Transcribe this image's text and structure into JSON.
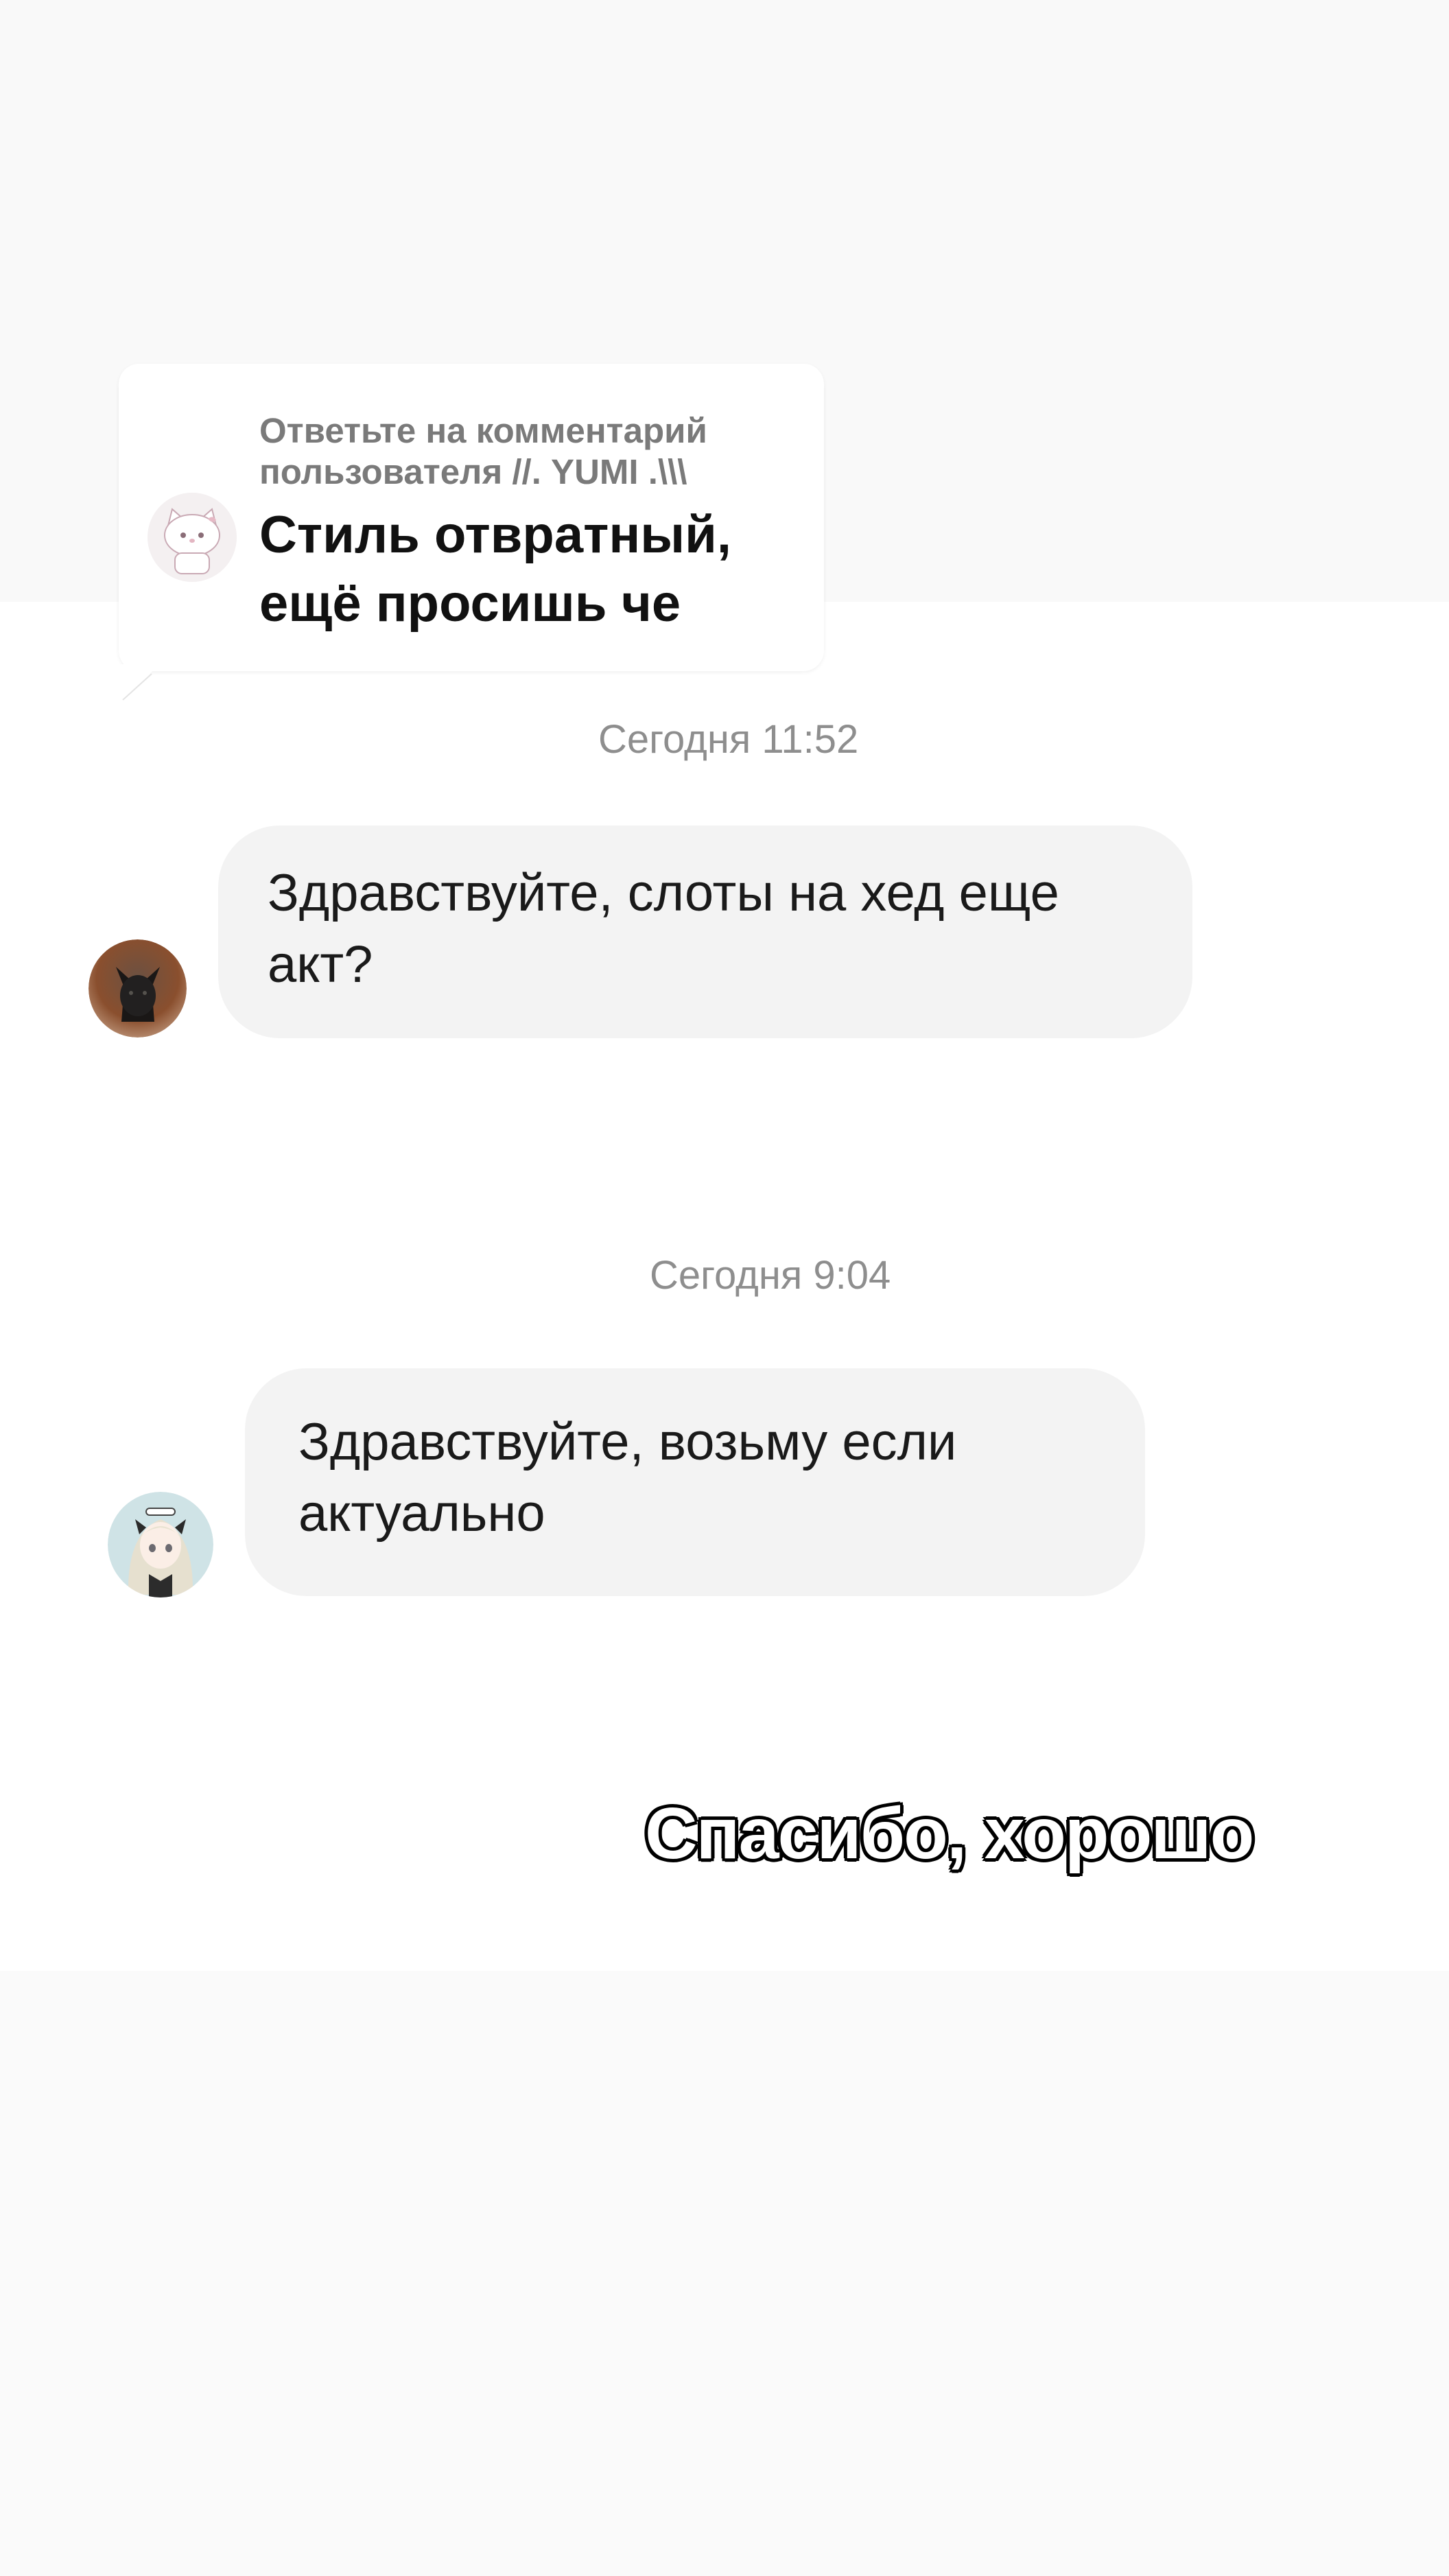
{
  "reply_card": {
    "header": "Ответьте на комментарий пользователя //. YUMI .\\\\\\",
    "comment": "Стиль отвратный, ещё просишь че",
    "avatar_icon": "hello-kitty-avatar-icon"
  },
  "messages": [
    {
      "timestamp": "Сегодня 11:52",
      "text": "Здравствуйте, слоты на хед еще акт?",
      "avatar_icon": "black-cat-avatar-icon"
    },
    {
      "timestamp": "Сегодня 9:04",
      "text": "Здравствуйте, возьму если актуально",
      "avatar_icon": "anime-girl-avatar-icon"
    }
  ],
  "caption": "Спасибо, хорошо",
  "colors": {
    "bubble": "#f3f3f3",
    "timestamp": "#8e8e8e",
    "caption_fill": "#ffffff",
    "caption_outline": "#000000"
  }
}
